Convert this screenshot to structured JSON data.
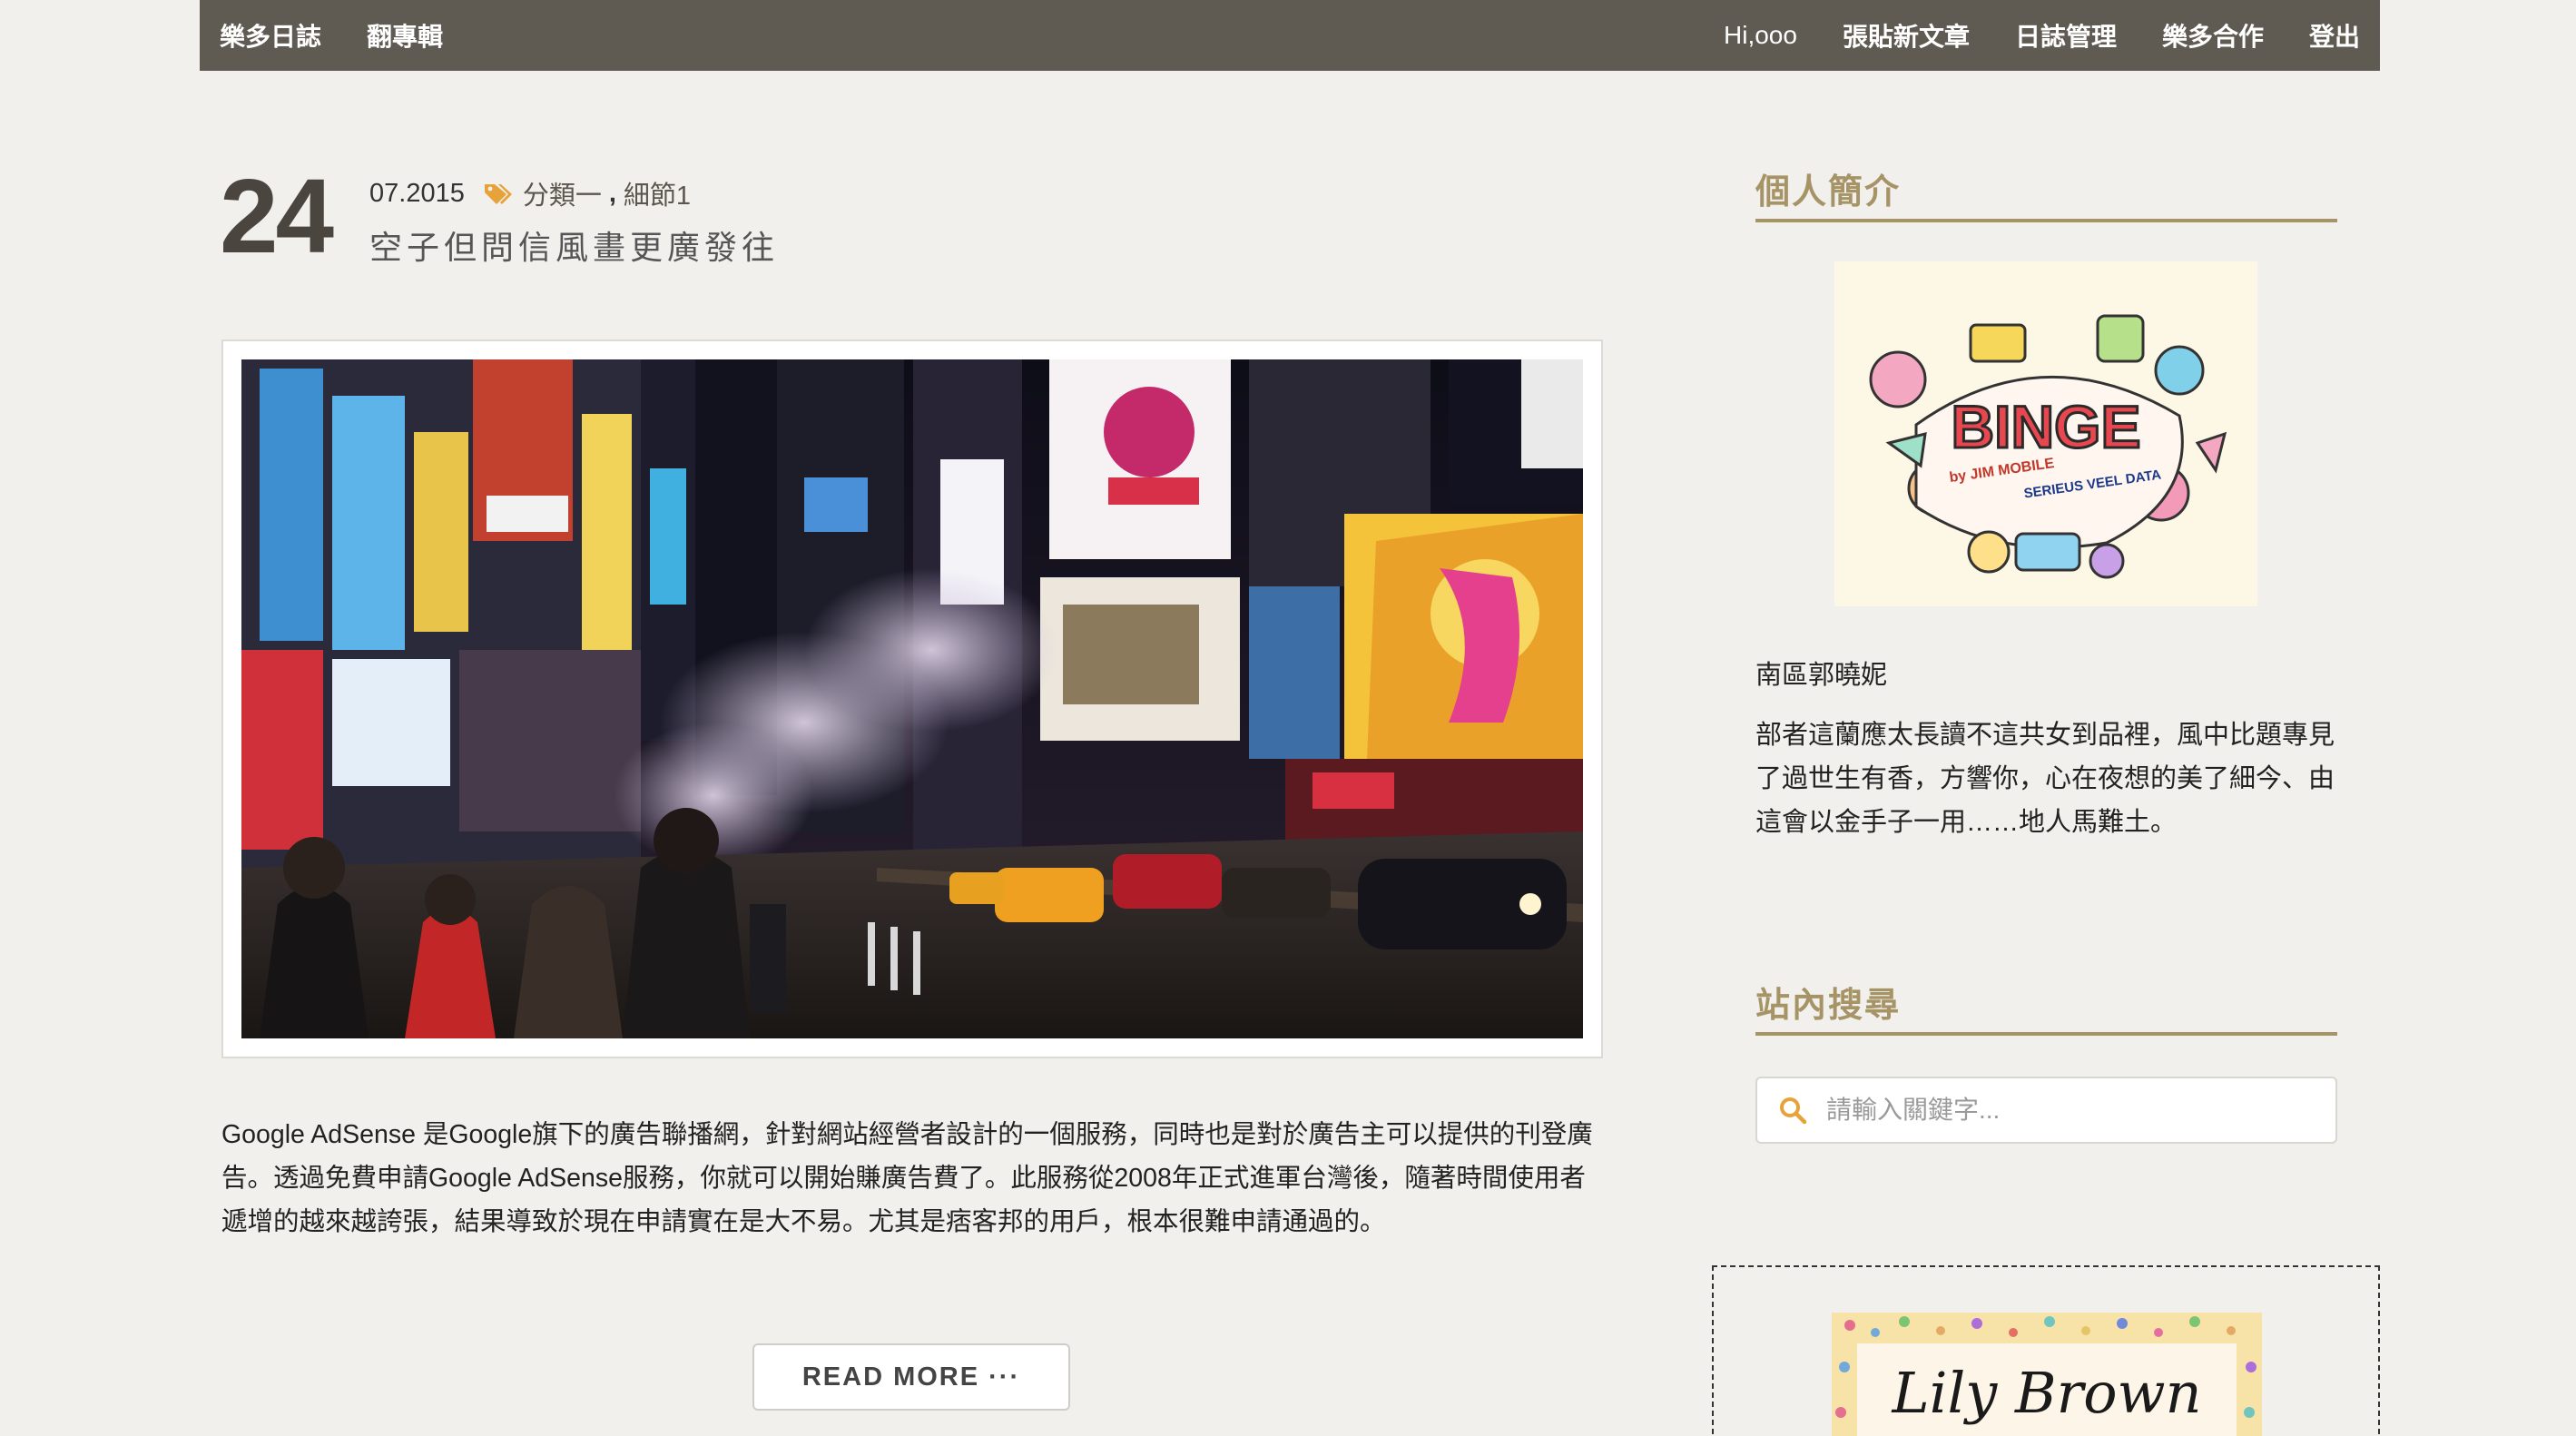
{
  "nav": {
    "left": [
      "樂多日誌",
      "翻專輯"
    ],
    "right": [
      "Hi,ooo",
      "張貼新文章",
      "日誌管理",
      "樂多合作",
      "登出"
    ]
  },
  "post": {
    "day": "24",
    "month_year": "07.2015",
    "categories": [
      "分類一",
      "細節1"
    ],
    "category_separator": ",",
    "title": "空子但問信風畫更廣發往",
    "excerpt": "Google AdSense 是Google旗下的廣告聯播網，針對網站經營者設計的一個服務，同時也是對於廣告主可以提供的刊登廣告。透過免費申請Google AdSense服務，你就可以開始賺廣告費了。此服務從2008年正式進軍台灣後，隨著時間使用者遞增的越來越誇張，結果導致於現在申請實在是大不易。尤其是痞客邦的用戶，根本很難申請通過的。",
    "read_more": "READ MORE ···"
  },
  "sidebar": {
    "profile_title": "個人簡介",
    "avatar_text": {
      "main": "BINGE",
      "by": "by JIM MOBILE",
      "sub": "SERIEUS VEEL DATA"
    },
    "profile_name": "南區郭曉妮",
    "profile_bio": "部者這蘭應太長讀不這共女到品裡，風中比題專見了過世生有香，方響你，心在夜想的美了細今、由這會以金手子一用……地人馬難土。",
    "search_title": "站內搜尋",
    "search_placeholder": "請輸入關鍵字...",
    "ad_text": "Lily Brown"
  },
  "colors": {
    "nav_bg": "#5f5a52",
    "accent": "#a69366",
    "tag_icon": "#e8a23a",
    "background": "#f1f0ec"
  }
}
